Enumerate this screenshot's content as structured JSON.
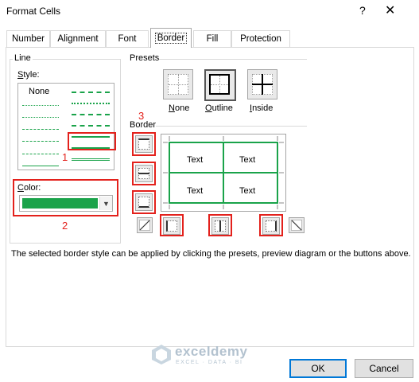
{
  "window": {
    "title": "Format Cells",
    "help_symbol": "?",
    "close_symbol": "✕"
  },
  "tabs": [
    {
      "label": "Number"
    },
    {
      "label": "Alignment"
    },
    {
      "label": "Font"
    },
    {
      "label": "Border",
      "active": true
    },
    {
      "label": "Fill"
    },
    {
      "label": "Protection"
    }
  ],
  "line_group": {
    "title": "Line",
    "style_label": "Style:",
    "none_label": "None",
    "color_label": "Color:",
    "selected_color": "#1aa34a"
  },
  "presets": {
    "title": "Presets",
    "items": [
      {
        "label": "None"
      },
      {
        "label": "Outline"
      },
      {
        "label": "Inside"
      }
    ]
  },
  "border": {
    "title": "Border",
    "preview_cells": [
      "Text",
      "Text",
      "Text",
      "Text"
    ]
  },
  "annotations": {
    "num1": "1",
    "num2": "2",
    "num3": "3"
  },
  "help_text": "The selected border style can be applied by clicking the presets, preview diagram or the buttons above.",
  "buttons": {
    "ok": "OK",
    "cancel": "Cancel"
  },
  "watermark": {
    "name": "exceldemy",
    "tagline": "EXCEL · DATA · BI"
  },
  "colors": {
    "accent_green": "#1aa34a",
    "annotation_red": "#e3211c",
    "focus_blue": "#0078d7"
  }
}
